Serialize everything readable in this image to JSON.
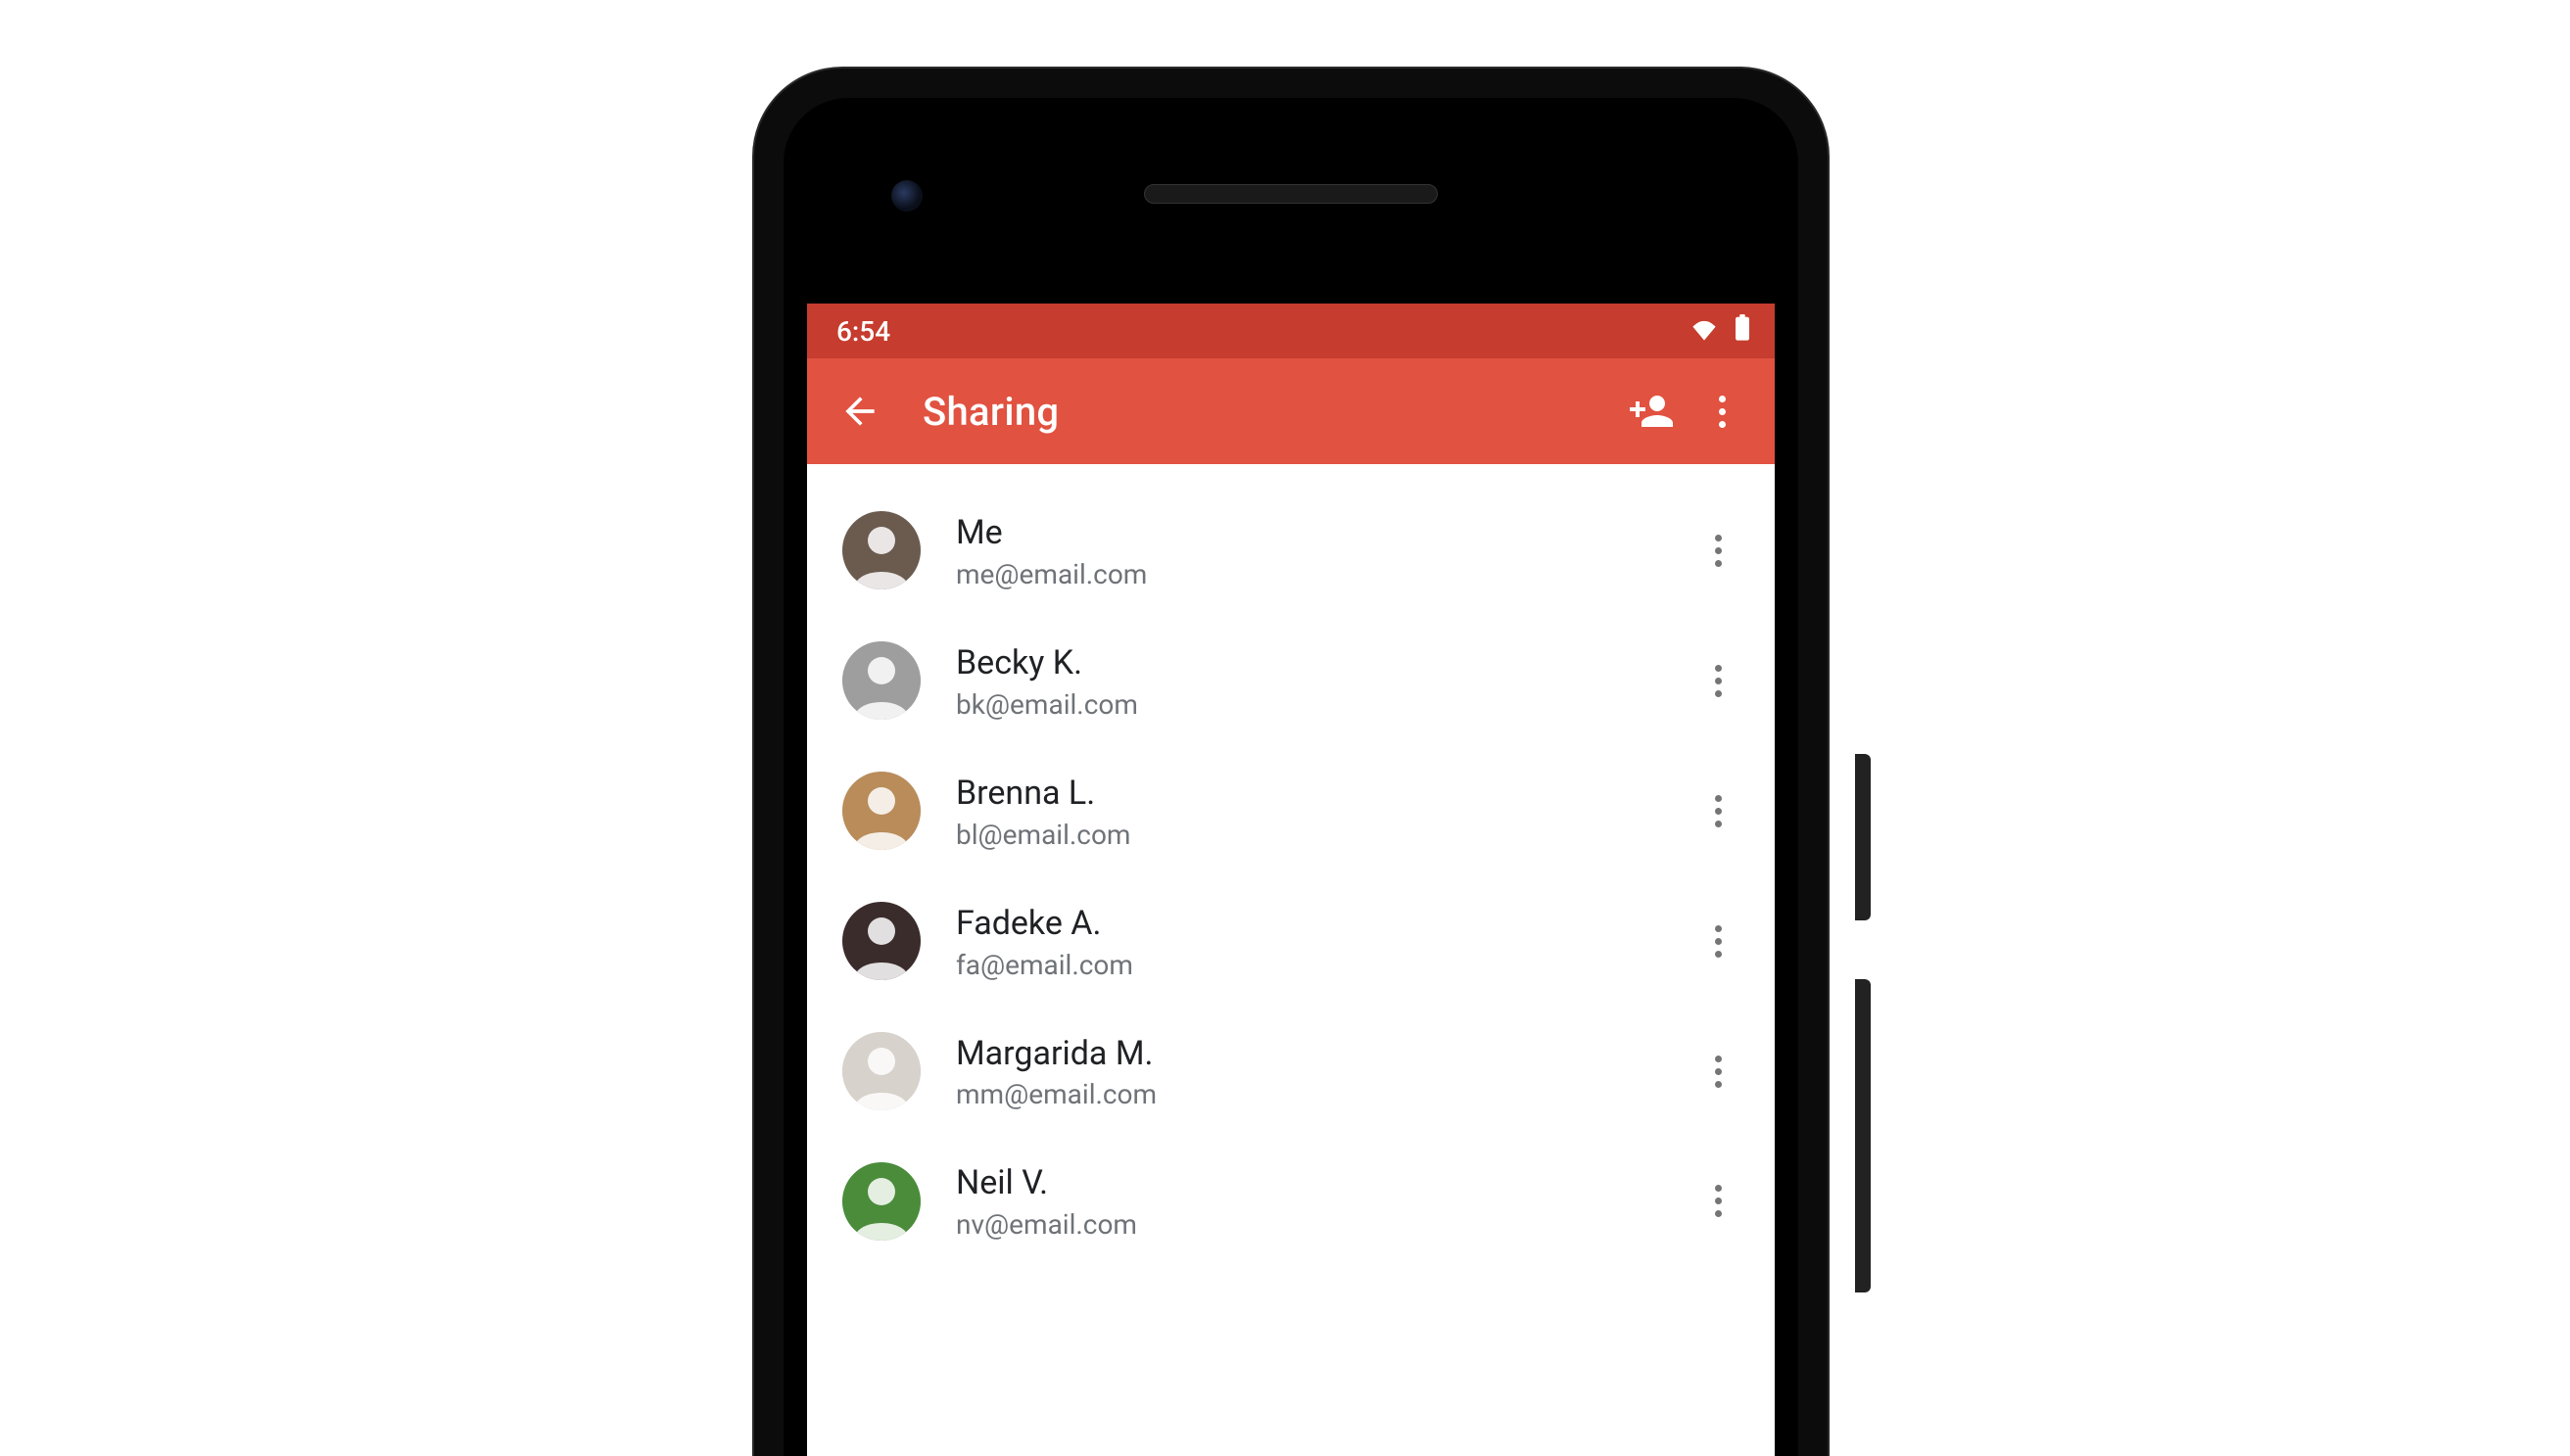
{
  "status_bar": {
    "time": "6:54",
    "wifi_icon": "wifi",
    "battery_icon": "battery-full"
  },
  "app_bar": {
    "title": "Sharing",
    "back_icon": "arrow-back",
    "add_person_icon": "person-add",
    "overflow_icon": "more-vert"
  },
  "contacts": [
    {
      "name": "Me",
      "email": "me@email.com",
      "avatar_color": "#6b5b4f"
    },
    {
      "name": "Becky K.",
      "email": "bk@email.com",
      "avatar_color": "#9e9e9e"
    },
    {
      "name": "Brenna L.",
      "email": "bl@email.com",
      "avatar_color": "#b98c5a"
    },
    {
      "name": "Fadeke A.",
      "email": "fa@email.com",
      "avatar_color": "#3b2c2c"
    },
    {
      "name": "Margarida M.",
      "email": "mm@email.com",
      "avatar_color": "#d7d2cb"
    },
    {
      "name": "Neil V.",
      "email": "nv@email.com",
      "avatar_color": "#4a8c3a"
    }
  ]
}
